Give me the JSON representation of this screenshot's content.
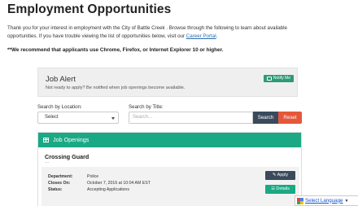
{
  "page": {
    "title": "Employment Opportunities",
    "intro_line1": "Thank you for your interest in employment with the City of Battle Creek . Browse through the following to learn about available",
    "intro_line2": "opportunities. If you have trouble viewing the list of opportunities below, visit our",
    "career_portal_link": "Career Portal",
    "intro_end": ".",
    "browser_note": "**We recommend that applicants use Chrome, Firefox, or Internet Explorer 10 or higher."
  },
  "job_alert": {
    "title": "Job Alert",
    "subtitle": "Not ready to apply? Be notified when job openings become available.",
    "notify_label": "Notify Me"
  },
  "search": {
    "location_label": "Search by Location:",
    "location_value": "Select",
    "title_label": "Search by Title:",
    "title_placeholder": "Search...",
    "search_button": "Search",
    "reset_button": "Reset"
  },
  "jobs": {
    "header": "Job Openings",
    "items": [
      {
        "title": "Crossing Guard",
        "ellipsis": "...",
        "department_label": "Department:",
        "department": "Police",
        "closes_label": "Closes On:",
        "closes": "October 7, 2016 at 10:04 AM EST",
        "status_label": "Status:",
        "status": "Accepting Applications",
        "apply_label": "Apply",
        "details_label": "Details"
      }
    ]
  },
  "translate": {
    "label": "Select Language",
    "arrow": "▼"
  },
  "colors": {
    "accent_green": "#1aa984",
    "dark_button": "#3a4a5c",
    "reset_orange": "#e4573a"
  }
}
